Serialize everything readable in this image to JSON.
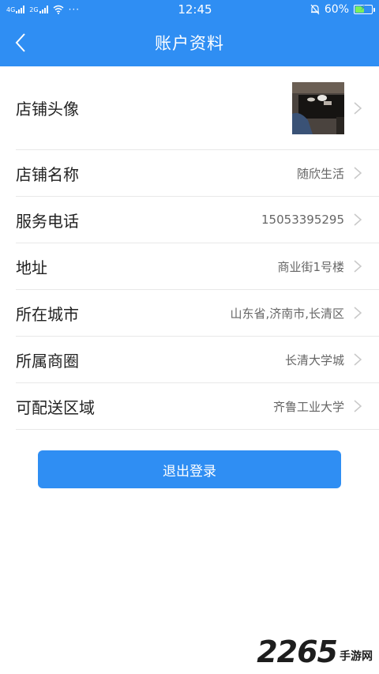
{
  "status_bar": {
    "sim1": "4G",
    "sim2": "2G",
    "more": "···",
    "time": "12:45",
    "battery_text": "60%",
    "battery_level": 0.6
  },
  "header": {
    "title": "账户资料"
  },
  "profile": {
    "avatar_label": "店铺头像",
    "rows": [
      {
        "label": "店铺名称",
        "value": "随欣生活"
      },
      {
        "label": "服务电话",
        "value": "15053395295"
      },
      {
        "label": "地址",
        "value": "商业街1号楼"
      },
      {
        "label": "所在城市",
        "value": "山东省,济南市,长清区"
      },
      {
        "label": "所属商圈",
        "value": "长清大学城"
      },
      {
        "label": "可配送区域",
        "value": "齐鲁工业大学"
      }
    ]
  },
  "actions": {
    "logout_label": "退出登录"
  },
  "watermark": {
    "number": "2265",
    "text": "手游网"
  },
  "colors": {
    "brand": "#2f8ef3"
  }
}
